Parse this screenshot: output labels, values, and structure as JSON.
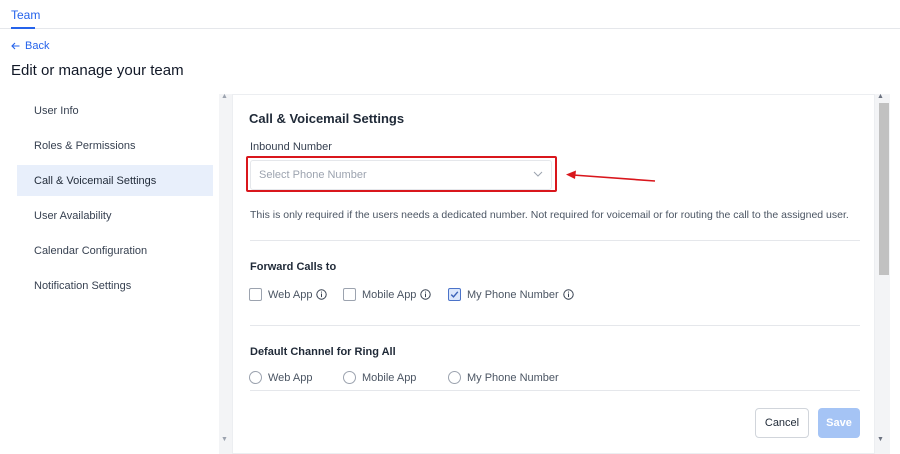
{
  "topbar": {
    "tab_label": "Team"
  },
  "nav": {
    "back_label": "Back"
  },
  "page": {
    "title": "Edit or manage your team"
  },
  "sidebar": {
    "items": [
      {
        "label": "User Info",
        "active": false
      },
      {
        "label": "Roles & Permissions",
        "active": false
      },
      {
        "label": "Call & Voicemail Settings",
        "active": true
      },
      {
        "label": "User Availability",
        "active": false
      },
      {
        "label": "Calendar Configuration",
        "active": false
      },
      {
        "label": "Notification Settings",
        "active": false
      }
    ]
  },
  "main": {
    "section_title": "Call & Voicemail Settings",
    "inbound": {
      "label": "Inbound Number",
      "placeholder": "Select Phone Number",
      "help_text": "This is only required if the users needs a dedicated number. Not required for voicemail or for routing the call to the assigned user."
    },
    "forward": {
      "title": "Forward Calls to",
      "options": [
        {
          "label": "Web App",
          "checked": false,
          "icon": "info-icon"
        },
        {
          "label": "Mobile App",
          "checked": false,
          "icon": "info-icon"
        },
        {
          "label": "My Phone Number",
          "checked": true,
          "icon": "info-icon"
        }
      ]
    },
    "ring_all": {
      "title": "Default Channel for Ring All",
      "options": [
        {
          "label": "Web App",
          "selected": false
        },
        {
          "label": "Mobile App",
          "selected": false
        },
        {
          "label": "My Phone Number",
          "selected": false
        }
      ]
    },
    "buttons": {
      "cancel": "Cancel",
      "save": "Save"
    }
  },
  "colors": {
    "accent": "#2563eb",
    "active_nav_bg": "#e8effb",
    "annotation_red": "#d9161c",
    "save_disabled": "#a5c4f5"
  }
}
